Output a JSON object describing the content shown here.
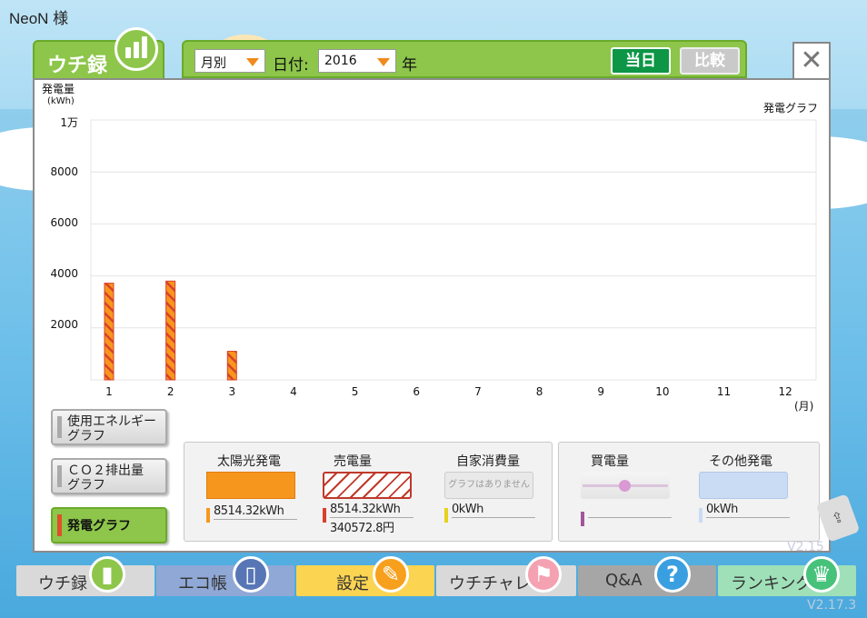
{
  "header": {
    "user": "NeoN 様"
  },
  "main_tab": {
    "title": "ウチ録"
  },
  "toolbar": {
    "period_select": "月別",
    "date_label": "日付:",
    "year_select": "2016",
    "year_suffix": "年",
    "today_button": "当日",
    "compare_button": "比較"
  },
  "chart": {
    "y_title": "発電量",
    "y_unit": "(kWh)",
    "title": "発電グラフ",
    "y_tick_labels": [
      "1万",
      "8000",
      "6000",
      "4000",
      "2000"
    ],
    "x_unit": "(月)"
  },
  "chart_data": {
    "type": "bar",
    "title": "発電グラフ",
    "ylabel": "発電量 (kWh)",
    "xlabel": "(月)",
    "categories": [
      "1",
      "2",
      "3",
      "4",
      "5",
      "6",
      "7",
      "8",
      "9",
      "10",
      "11",
      "12"
    ],
    "values": [
      3720,
      3800,
      1100,
      0,
      0,
      0,
      0,
      0,
      0,
      0,
      0,
      0
    ],
    "ylim": [
      0,
      10000
    ],
    "grid": true,
    "colors": {
      "bar_fill": "#f7961d",
      "bar_stripe": "#d8412b"
    }
  },
  "side_buttons": [
    {
      "label": "使用エネルギーグラフ",
      "line1": "使用エネルギー",
      "line2": "グラフ"
    },
    {
      "label": "ＣＯ２排出量グラフ",
      "line1": "ＣＯ２排出量",
      "line2": "グラフ"
    },
    {
      "label": "発電グラフ"
    }
  ],
  "legend": {
    "solar": {
      "name": "太陽光発電",
      "value": "8514.32kWh"
    },
    "sale": {
      "name": "売電量",
      "value": "8514.32kWh",
      "amount": "340572.8円"
    },
    "self": {
      "name": "自家消費量",
      "placeholder": "グラフはありません",
      "value": "0kWh"
    },
    "buy": {
      "name": "買電量",
      "value": ""
    },
    "other": {
      "name": "その他発電",
      "value": "0kWh"
    }
  },
  "nav": [
    {
      "label": "ウチ録",
      "color": "#d9d9d9",
      "icon_color": "#8dc64a"
    },
    {
      "label": "エコ帳",
      "color": "#8fa8d6",
      "icon_color": "#5876b6"
    },
    {
      "label": "設定",
      "color": "#fbd452",
      "icon_color": "#f7a01d"
    },
    {
      "label": "ウチチャレ",
      "color": "#d9d9d9",
      "icon_color": "#f4a1b1"
    },
    {
      "label": "Q&A",
      "color": "#a6a6a6",
      "icon_color": "#3a9fe0"
    },
    {
      "label": "ランキング",
      "color": "#9fe0b8",
      "icon_color": "#47c27a"
    }
  ],
  "version_faint": "V2.15",
  "version": "V2.17.3"
}
